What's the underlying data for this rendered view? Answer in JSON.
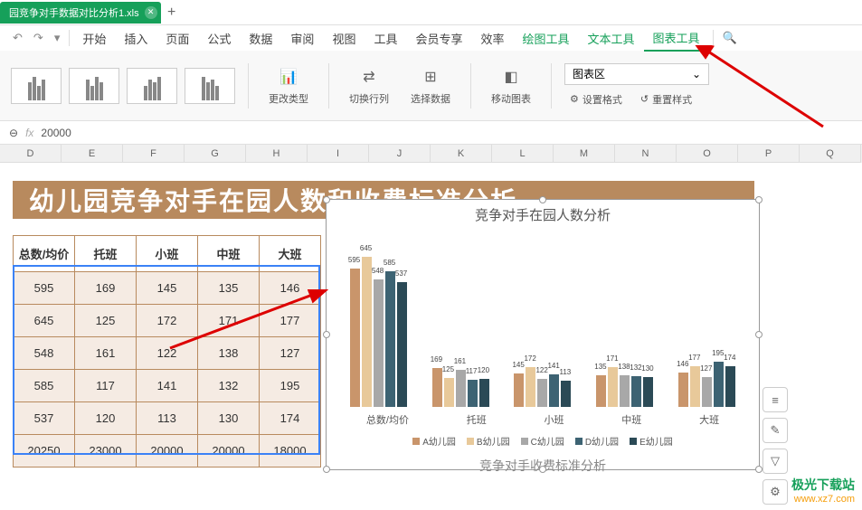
{
  "titlebar": {
    "filename": "园竞争对手数据对比分析1.xls",
    "add": "+"
  },
  "menubar": {
    "undo": "↶",
    "redo": "↷",
    "items": [
      "开始",
      "插入",
      "页面",
      "公式",
      "数据",
      "审阅",
      "视图",
      "工具",
      "会员专享",
      "效率"
    ],
    "tools": [
      "绘图工具",
      "文本工具",
      "图表工具"
    ],
    "search": "🔍"
  },
  "ribbon": {
    "changeType": "更改类型",
    "switchRowCol": "切换行列",
    "selectData": "选择数据",
    "moveChart": "移动图表",
    "areaLabel": "图表区",
    "setFormat": "设置格式",
    "resetStyle": "重置样式"
  },
  "formulabar": {
    "zoom": "⊖",
    "fx": "fx",
    "value": "20000"
  },
  "columns": [
    "D",
    "E",
    "F",
    "G",
    "H",
    "I",
    "J",
    "K",
    "L",
    "M",
    "N",
    "O",
    "P",
    "Q"
  ],
  "banner": "幼儿园竞争对手在园人数和收费标准分析",
  "table": {
    "headers": [
      "总数/均价",
      "托班",
      "小班",
      "中班",
      "大班"
    ],
    "rows": [
      [
        "595",
        "169",
        "145",
        "135",
        "146"
      ],
      [
        "645",
        "125",
        "172",
        "171",
        "177"
      ],
      [
        "548",
        "161",
        "122",
        "138",
        "127"
      ],
      [
        "585",
        "117",
        "141",
        "132",
        "195"
      ],
      [
        "537",
        "120",
        "113",
        "130",
        "174"
      ],
      [
        "20250",
        "23000",
        "20000",
        "20000",
        "18000"
      ]
    ]
  },
  "chart_data": {
    "type": "bar",
    "title": "竞争对手在园人数分析",
    "categories": [
      "总数/均价",
      "托班",
      "小班",
      "中班",
      "大班"
    ],
    "series": [
      {
        "name": "A幼儿园",
        "color": "#c9956b",
        "values": [
          595,
          169,
          145,
          135,
          146
        ]
      },
      {
        "name": "B幼儿园",
        "color": "#e8c99a",
        "values": [
          645,
          125,
          172,
          171,
          177
        ]
      },
      {
        "name": "C幼儿园",
        "color": "#a8a8a8",
        "values": [
          548,
          161,
          122,
          138,
          127
        ]
      },
      {
        "name": "D幼儿园",
        "color": "#3d6373",
        "values": [
          585,
          117,
          141,
          132,
          195
        ]
      },
      {
        "name": "E幼儿园",
        "color": "#2b4a56",
        "values": [
          537,
          120,
          113,
          130,
          174
        ]
      }
    ],
    "ylim": [
      0,
      700
    ],
    "subtitle": "竞争对手收费标准分析"
  },
  "watermark": {
    "site": "极光下载站",
    "url": "www.xz7.com"
  }
}
